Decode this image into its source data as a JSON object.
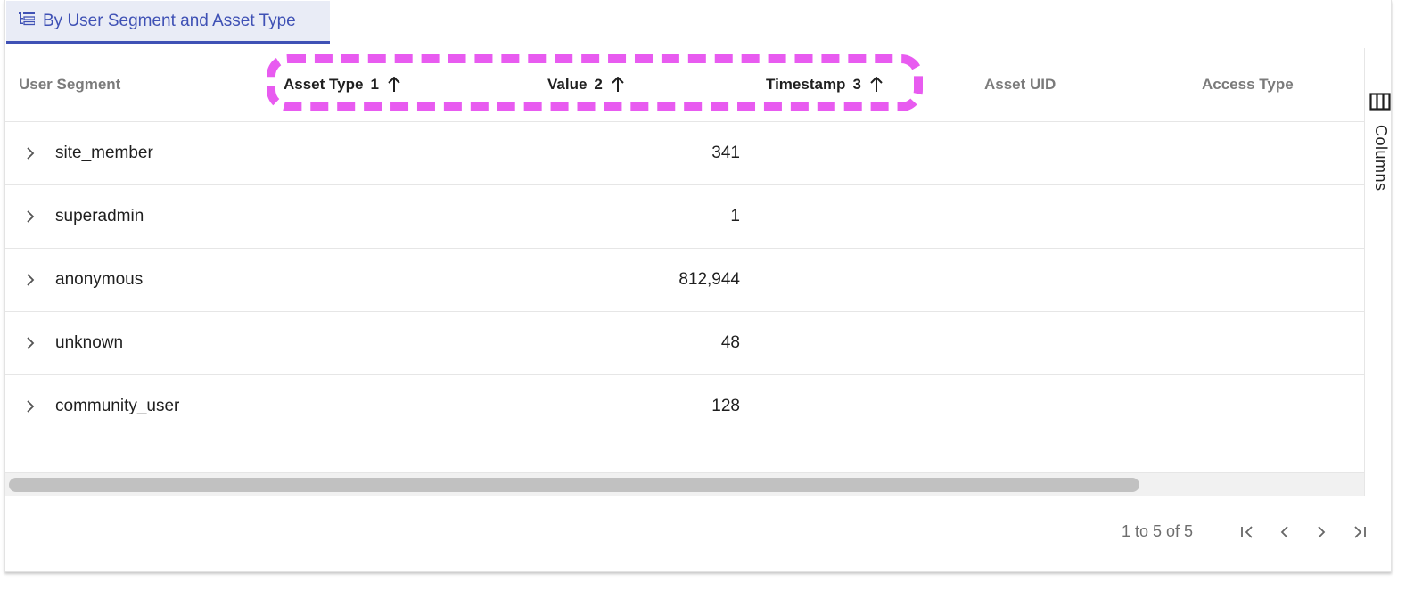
{
  "group_tab": {
    "label": "By User Segment and Asset Type",
    "icon": "tree-group-icon",
    "accent_color": "#3f51b5"
  },
  "columns": [
    {
      "label": "User Segment",
      "sort_index": "",
      "sorted": false
    },
    {
      "label": "Asset Type",
      "sort_index": "1",
      "sorted": true,
      "sort_direction": "ascending"
    },
    {
      "label": "Value",
      "sort_index": "2",
      "sorted": true,
      "sort_direction": "ascending"
    },
    {
      "label": "Timestamp",
      "sort_index": "3",
      "sorted": true,
      "sort_direction": "ascending"
    },
    {
      "label": "Asset UID",
      "sort_index": "",
      "sorted": false
    },
    {
      "label": "Access Type",
      "sort_index": "",
      "sorted": false
    }
  ],
  "rows": [
    {
      "segment": "site_member",
      "value": "341"
    },
    {
      "segment": "superadmin",
      "value": "1"
    },
    {
      "segment": "anonymous",
      "value": "812,944"
    },
    {
      "segment": "unknown",
      "value": "48"
    },
    {
      "segment": "community_user",
      "value": "128"
    }
  ],
  "side_panel": {
    "columns_label": "Columns",
    "icon": "columns-icon"
  },
  "pagination": {
    "summary": "1 to 5 of 5",
    "buttons": [
      "first-page",
      "previous-page",
      "next-page",
      "last-page"
    ]
  },
  "highlight_color": "#e85bf0"
}
